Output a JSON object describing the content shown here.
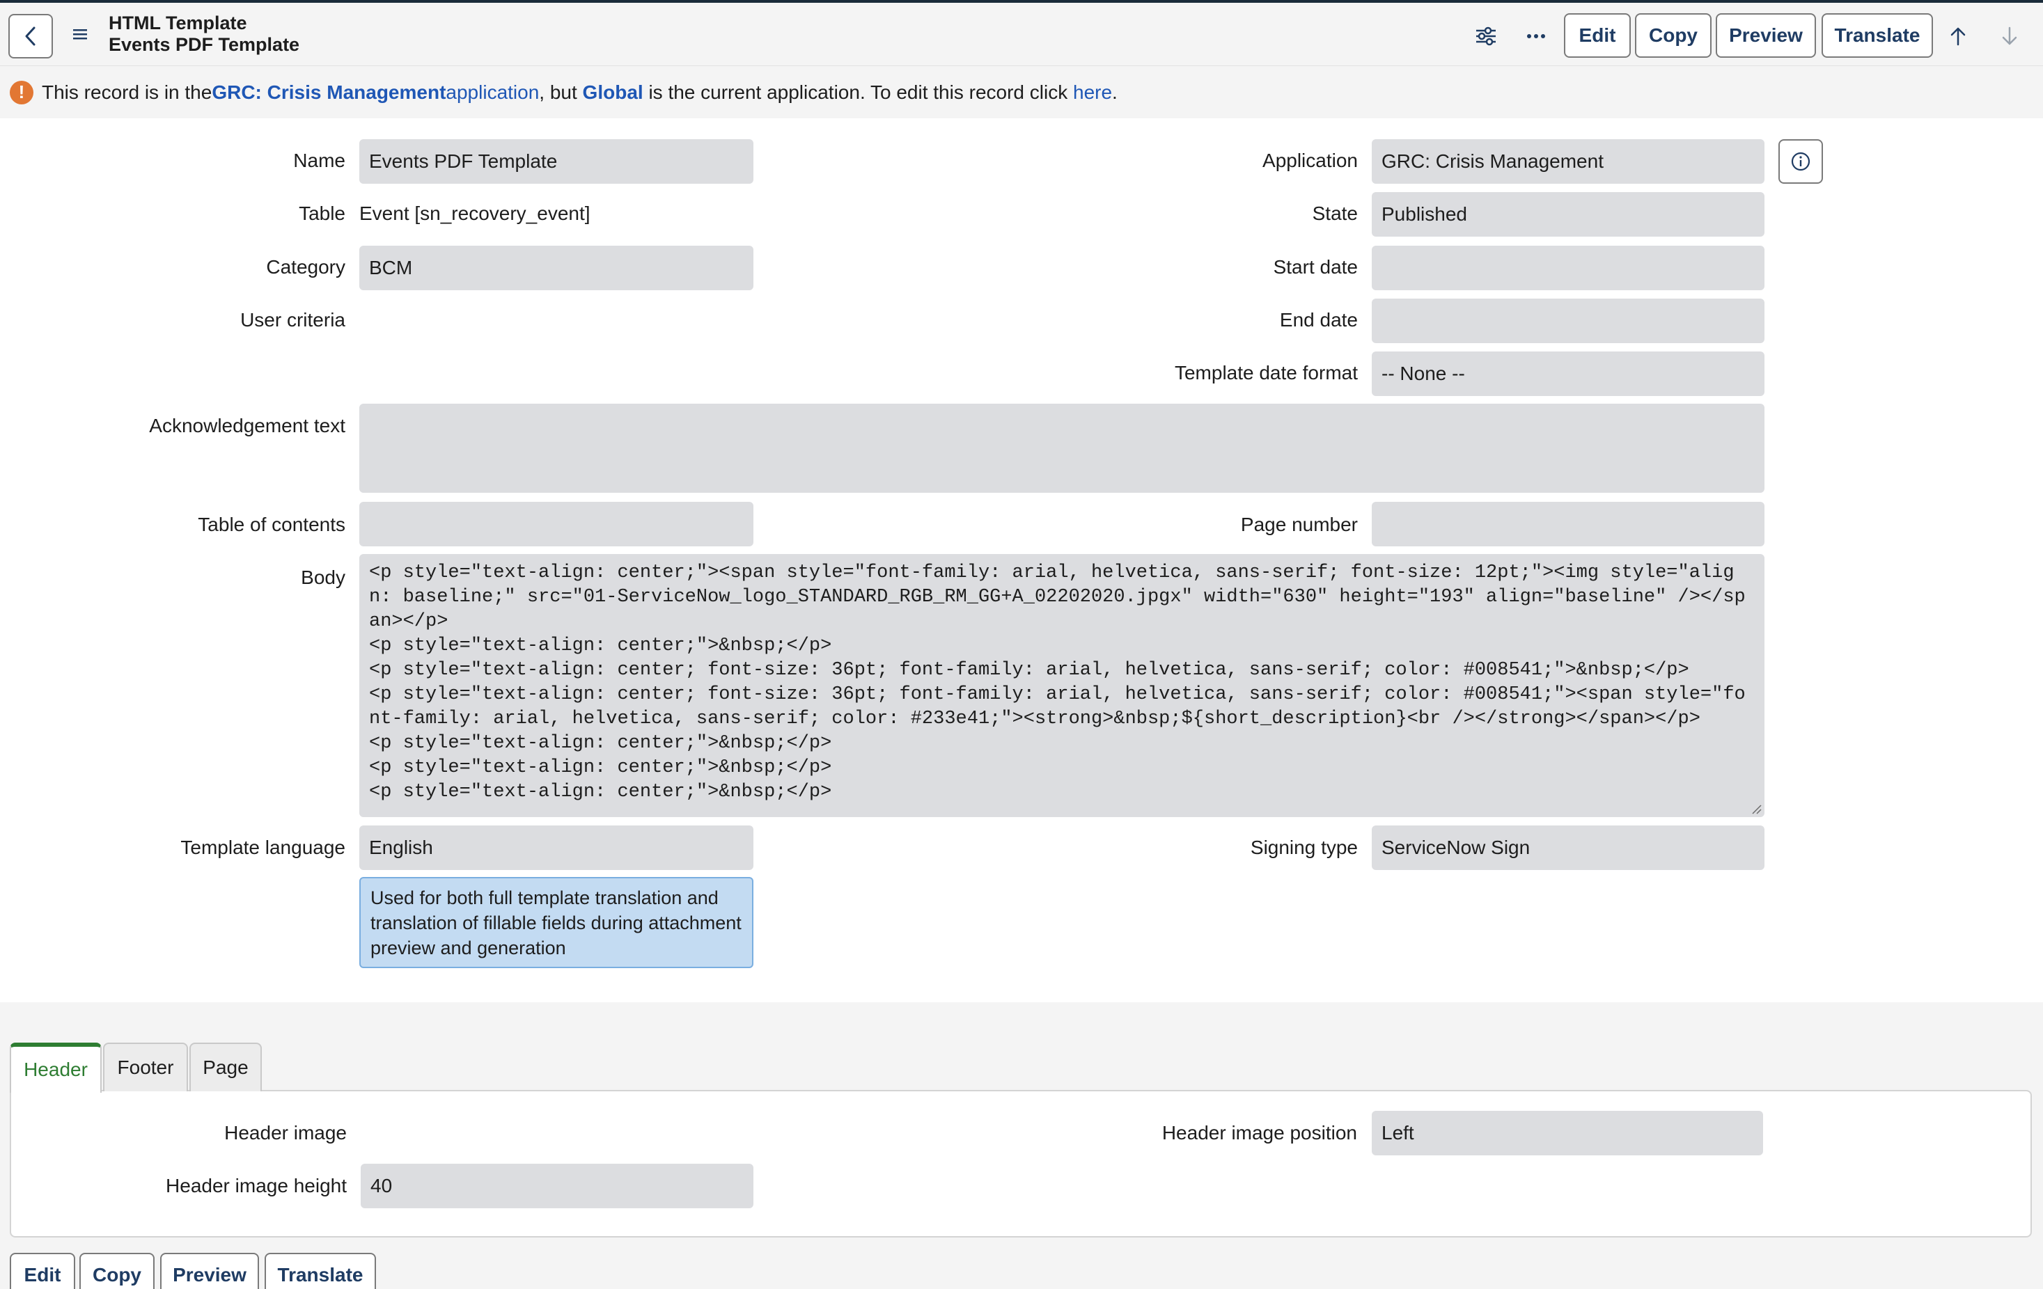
{
  "header": {
    "title": "HTML Template",
    "subtitle": "Events PDF Template",
    "buttons": {
      "edit": "Edit",
      "copy": "Copy",
      "preview": "Preview",
      "translate": "Translate"
    },
    "icons": {
      "back": "chevron-left-icon",
      "menu": "hamburger-icon",
      "settings": "sliders-icon",
      "more": "ellipsis-icon",
      "prev": "arrow-up-icon",
      "next": "arrow-down-icon"
    }
  },
  "banner": {
    "t1": "This record is in the ",
    "app_link": "GRC: Crisis Management",
    "app_word": " application",
    "t2": ", but ",
    "global_link": "Global",
    "t3": " is the current application. To edit this record click ",
    "here_link": "here",
    "t4": "."
  },
  "form": {
    "name": {
      "label": "Name",
      "value": "Events PDF Template"
    },
    "table": {
      "label": "Table",
      "value": "Event [sn_recovery_event]"
    },
    "category": {
      "label": "Category",
      "value": "BCM"
    },
    "user_criteria": {
      "label": "User criteria",
      "value": ""
    },
    "ack_text": {
      "label": "Acknowledgement text",
      "value": ""
    },
    "toc": {
      "label": "Table of contents",
      "value": ""
    },
    "body": {
      "label": "Body",
      "value": "<p style=\"text-align: center;\"><span style=\"font-family: arial, helvetica, sans-serif; font-size: 12pt;\"><img style=\"align: baseline;\" src=\"01-ServiceNow_logo_STANDARD_RGB_RM_GG+A_02202020.jpgx\" width=\"630\" height=\"193\" align=\"baseline\" /></span></p>\n<p style=\"text-align: center;\">&nbsp;</p>\n<p style=\"text-align: center; font-size: 36pt; font-family: arial, helvetica, sans-serif; color: #008541;\">&nbsp;</p>\n<p style=\"text-align: center; font-size: 36pt; font-family: arial, helvetica, sans-serif; color: #008541;\"><span style=\"font-family: arial, helvetica, sans-serif; color: #233e41;\"><strong>&nbsp;${short_description}<br /></strong></span></p>\n<p style=\"text-align: center;\">&nbsp;</p>\n<p style=\"text-align: center;\">&nbsp;</p>\n<p style=\"text-align: center;\">&nbsp;</p>"
    },
    "template_language": {
      "label": "Template language",
      "value": "English"
    },
    "language_hint": "Used for both full template translation and translation of fillable fields during attachment preview and generation",
    "application": {
      "label": "Application",
      "value": "GRC: Crisis Management"
    },
    "state": {
      "label": "State",
      "value": "Published"
    },
    "start_date": {
      "label": "Start date",
      "value": ""
    },
    "end_date": {
      "label": "End date",
      "value": ""
    },
    "date_format": {
      "label": "Template date format",
      "value": "-- None --"
    },
    "page_number": {
      "label": "Page number",
      "value": ""
    },
    "signing_type": {
      "label": "Signing type",
      "value": "ServiceNow Sign"
    }
  },
  "tabs": {
    "items": [
      "Header",
      "Footer",
      "Page"
    ],
    "active": "Header",
    "header_image": {
      "label": "Header image",
      "value": ""
    },
    "header_image_height": {
      "label": "Header image height",
      "value": "40"
    },
    "header_image_position": {
      "label": "Header image position",
      "value": "Left"
    }
  },
  "bottom_buttons": {
    "edit": "Edit",
    "copy": "Copy",
    "preview": "Preview",
    "translate": "Translate"
  },
  "colors": {
    "accent": "#1f3c63",
    "link": "#1f57b5",
    "warning": "#e27733",
    "active_tab": "#2e7d32",
    "field_bg": "#dcdde0",
    "hint_bg": "#c3dbf2"
  }
}
